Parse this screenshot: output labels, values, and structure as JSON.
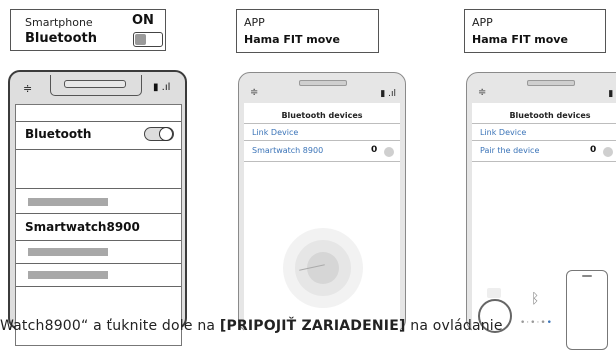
{
  "caption1": {
    "label": "Smartphone",
    "title": "Bluetooth",
    "state": "ON"
  },
  "caption2": {
    "label": "APP",
    "title": "Hama FIT move"
  },
  "caption3": {
    "label": "APP",
    "title": "Hama FIT move"
  },
  "phone1": {
    "bluetooth_label": "Bluetooth",
    "device_name": "Smartwatch8900"
  },
  "phone2": {
    "screen_title": "Bluetooth devices",
    "link_label": "Link Device",
    "device_label": "Smartwatch 8900"
  },
  "phone3": {
    "screen_title": "Bluetooth devices",
    "link_label": "Link Device",
    "device_label": "Pair the device"
  },
  "bottom": {
    "pre": "Watch8900“ a ťuknite dole na ",
    "bold": "[PRIPOJIŤ ZARIADENIE]",
    "post": " na ovládanie"
  },
  "icons": {
    "phone1_wifi": "wifi-icon",
    "bluetooth_symbol": "bluetooth-icon",
    "link_icon": "link-icon"
  }
}
